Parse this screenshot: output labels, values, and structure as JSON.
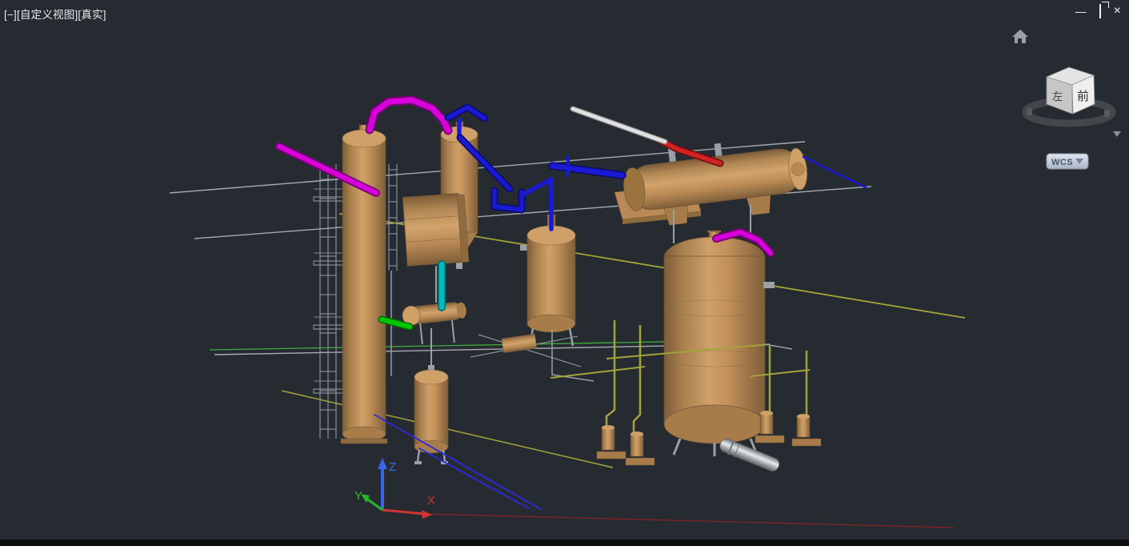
{
  "viewport_controls": {
    "minus": "[−]",
    "view_name": "[自定义视图]",
    "visual_style": "[真实]"
  },
  "window_controls": {
    "minimize_glyph": "—",
    "restore_icon": "overlapping-squares",
    "close_glyph": "×"
  },
  "viewcube": {
    "home_icon": "house-shape",
    "face_left": "左",
    "face_front": "前",
    "wcs": {
      "label": "WCS",
      "dropdown_arrow": "▼"
    }
  },
  "ucs_axes": {
    "x": "X",
    "y": "Y",
    "z": "Z"
  },
  "colors": {
    "background": "#262b31",
    "vessel_tan": "#c09058",
    "vessel_shadow": "#8f6a3e",
    "pipe_magenta": "#d800d8",
    "pipe_blue": "#1a1ad4",
    "pipe_red": "#d42222",
    "pipe_cyan": "#00bcbc",
    "pipe_green": "#00c400",
    "pipe_olive": "#a3a33b",
    "pipe_white": "#e2e2e2",
    "line_gray": "#a6abb1",
    "axis_x_red": "#d23333",
    "axis_y_green": "#2bb52b",
    "axis_z_blue": "#3a66e8",
    "wcs_pill": "#c3ccd9"
  }
}
